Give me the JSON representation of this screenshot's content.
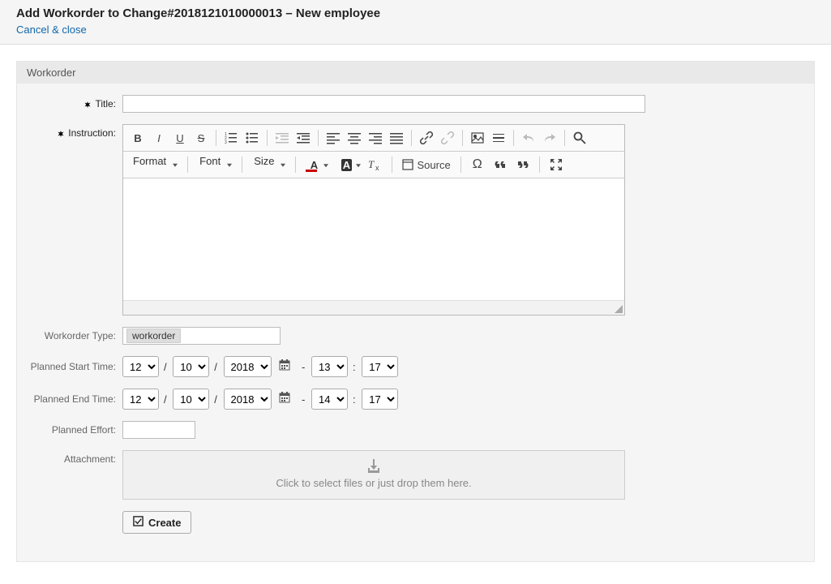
{
  "header": {
    "title": "Add Workorder to Change#2018121010000013 – New employee",
    "cancel_link": "Cancel & close"
  },
  "panel": {
    "title": "Workorder"
  },
  "labels": {
    "title": "Title:",
    "instruction": "Instruction:",
    "workorder_type": "Workorder Type:",
    "planned_start": "Planned Start Time:",
    "planned_end": "Planned End Time:",
    "planned_effort": "Planned Effort:",
    "attachment": "Attachment:"
  },
  "editor": {
    "format": "Format",
    "font": "Font",
    "size": "Size",
    "source": "Source"
  },
  "fields": {
    "title_value": "",
    "workorder_type_value": "workorder",
    "effort_value": ""
  },
  "date_start": {
    "month": "12",
    "day": "10",
    "year": "2018",
    "hour": "13",
    "minute": "17"
  },
  "date_end": {
    "month": "12",
    "day": "10",
    "year": "2018",
    "hour": "14",
    "minute": "17"
  },
  "attachment_text": "Click to select files or just drop them here.",
  "buttons": {
    "create": "Create"
  }
}
